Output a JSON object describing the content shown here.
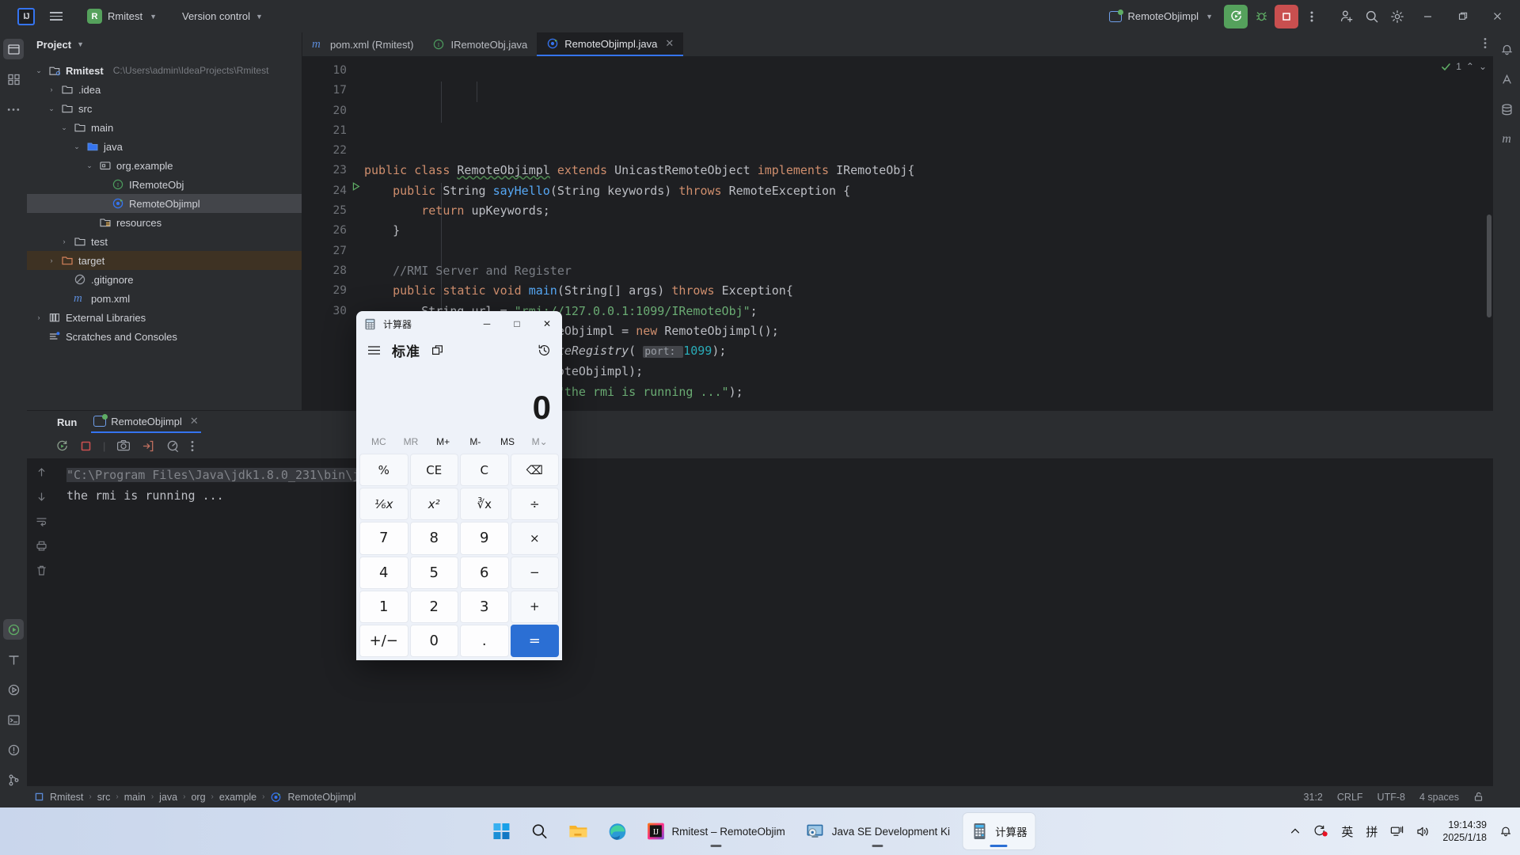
{
  "ide": {
    "toolbar": {
      "logo_initials": "IJ",
      "menu_icon": "hamburger-icon",
      "project_badge": "R",
      "project_name": "Rmitest",
      "version_control": "Version control",
      "run_config": "RemoteObjimpl",
      "icons": {
        "run": "run-icon",
        "debug": "debug-bug-icon",
        "stop": "stop-icon",
        "more": "more-vertical-icon",
        "account": "account-add-icon",
        "search": "search-icon",
        "settings": "gear-icon",
        "minimize": "minimize-icon",
        "restore": "restore-icon",
        "close": "close-icon"
      }
    },
    "project_panel": {
      "title": "Project",
      "tree": [
        {
          "label": "Rmitest",
          "path": "C:\\Users\\admin\\IdeaProjects\\Rmitest",
          "indent": 0,
          "arrow": "v",
          "icon": "module-icon",
          "bold": true,
          "state": "normal"
        },
        {
          "label": ".idea",
          "path": "",
          "indent": 1,
          "arrow": ">",
          "icon": "folder-icon",
          "bold": false,
          "state": "normal"
        },
        {
          "label": "src",
          "path": "",
          "indent": 1,
          "arrow": "v",
          "icon": "folder-icon",
          "bold": false,
          "state": "normal"
        },
        {
          "label": "main",
          "path": "",
          "indent": 2,
          "arrow": "v",
          "icon": "folder-icon",
          "bold": false,
          "state": "normal"
        },
        {
          "label": "java",
          "path": "",
          "indent": 3,
          "arrow": "v",
          "icon": "source-folder-icon",
          "bold": false,
          "state": "normal"
        },
        {
          "label": "org.example",
          "path": "",
          "indent": 4,
          "arrow": "v",
          "icon": "package-icon",
          "bold": false,
          "state": "normal"
        },
        {
          "label": "IRemoteObj",
          "path": "",
          "indent": 5,
          "arrow": "",
          "icon": "interface-icon",
          "bold": false,
          "state": "normal"
        },
        {
          "label": "RemoteObjimpl",
          "path": "",
          "indent": 5,
          "arrow": "",
          "icon": "class-runnable-icon",
          "bold": false,
          "state": "selected"
        },
        {
          "label": "resources",
          "path": "",
          "indent": 4,
          "arrow": "",
          "icon": "resources-folder-icon",
          "bold": false,
          "state": "normal"
        },
        {
          "label": "test",
          "path": "",
          "indent": 2,
          "arrow": ">",
          "icon": "folder-icon",
          "bold": false,
          "state": "normal"
        },
        {
          "label": "target",
          "path": "",
          "indent": 1,
          "arrow": ">",
          "icon": "excluded-folder-icon",
          "bold": false,
          "state": "target"
        },
        {
          "label": ".gitignore",
          "path": "",
          "indent": 2,
          "arrow": "",
          "icon": "gitignore-icon",
          "bold": false,
          "state": "normal"
        },
        {
          "label": "pom.xml",
          "path": "",
          "indent": 2,
          "arrow": "",
          "icon": "maven-icon",
          "bold": false,
          "state": "normal"
        },
        {
          "label": "External Libraries",
          "path": "",
          "indent": 0,
          "arrow": ">",
          "icon": "libraries-icon",
          "bold": false,
          "state": "normal"
        },
        {
          "label": "Scratches and Consoles",
          "path": "",
          "indent": 0,
          "arrow": "",
          "icon": "scratches-icon",
          "bold": false,
          "state": "normal"
        }
      ]
    },
    "editor": {
      "tabs": [
        {
          "label": "pom.xml (Rmitest)",
          "icon": "maven-icon",
          "active": false,
          "closable": false
        },
        {
          "label": "IRemoteObj.java",
          "icon": "interface-icon",
          "active": false,
          "closable": false
        },
        {
          "label": "RemoteObjimpl.java",
          "icon": "class-runnable-icon",
          "active": true,
          "closable": true
        }
      ],
      "inspection_count": "1",
      "line_numbers": [
        "10",
        "17",
        "20",
        "21",
        "22",
        "23",
        "24",
        "25",
        "26",
        "27",
        "28",
        "29",
        "30"
      ],
      "run_marker_line": "24"
    },
    "run_panel": {
      "title": "Run",
      "tab_label": "RemoteObjimpl",
      "toolbar_icons": [
        "rerun-icon",
        "stop-icon",
        "camera-icon",
        "export-icon",
        "profiler-icon",
        "more-vertical-icon"
      ],
      "side_icons": [
        "scroll-up-icon",
        "scroll-down-icon",
        "soft-wrap-icon",
        "print-icon",
        "trash-icon"
      ],
      "console": [
        {
          "text": "\"C:\\Program Files\\Java\\jdk1.8.0_231\\bin\\ja",
          "style": "dim"
        },
        {
          "text": "the rmi is running ...",
          "style": "out"
        }
      ]
    },
    "status_bar": {
      "breadcrumbs": [
        "Rmitest",
        "src",
        "main",
        "java",
        "org",
        "example",
        "RemoteObjimpl"
      ],
      "caret": "31:2",
      "line_sep": "CRLF",
      "encoding": "UTF-8",
      "indent": "4 spaces",
      "lock_icon": "lock-open-icon"
    }
  },
  "code": {
    "lines": [
      {
        "n": "10",
        "html": "kw:public |kw:class |cls:RemoteObjimpl| |kw:extends |cls:UnicastRemoteObject| |kw:implements |cls:IRemoteObj|pun:{"
      },
      {
        "n": "17",
        "html": "indent1|kw:public |cls:String |mtd:sayHello|pun:(|cls:String |pun:keywords) |kw:throws |cls:RemoteException |pun:{"
      },
      {
        "n": "20",
        "html": "indent2|kw:return |pun:upKeywords;"
      },
      {
        "n": "21",
        "html": "indent1|pun:}"
      },
      {
        "n": "22",
        "html": ""
      },
      {
        "n": "23",
        "html": "indent1|cmt://RMI Server and Register"
      },
      {
        "n": "24",
        "html": "indent1|kw:public static void |mtd:main|pun:(|cls:String|pun:[] args) |kw:throws |cls:Exception|pun:{"
      },
      {
        "n": "25",
        "html": "indent2|cls:String |pun:url = |str:\"rmi://127.0.0.1:1099/IRemoteObj\"|pun:;"
      },
      {
        "n": "26",
        "html": "indent2|cls:RemoteObjimpl |pun:remoteObjimpl = |kw:new |cls:RemoteObjimpl|pun:();"
      },
      {
        "n": "27",
        "html": "indent2|cls:LocateRegistry|pun:.|ital:createRegistry|pun:( |hint:port: |num:1099|pun:);"
      },
      {
        "n": "28",
        "html": "indent2|cls:Naming|pun:.|ital:bind|pun:(url,remoteObjimpl);"
      },
      {
        "n": "29",
        "html": "indent2|cls:System|pun:.|fld:out|pun:.|pun:println(|str:\"the rmi is running ...\"|pun:);"
      },
      {
        "n": "30",
        "html": "indent1|pun:}"
      }
    ]
  },
  "calculator": {
    "window_title": "计算器",
    "icon": "calculator-icon",
    "window_buttons": {
      "minimize": "─",
      "maximize": "□",
      "close": "✕"
    },
    "menu_icon": "hamburger-icon",
    "mode": "标准",
    "keep_on_top_icon": "keep-on-top-icon",
    "history_icon": "history-icon",
    "display_value": "0",
    "memory_keys": [
      {
        "label": "MC",
        "enabled": false
      },
      {
        "label": "MR",
        "enabled": false
      },
      {
        "label": "M+",
        "enabled": true
      },
      {
        "label": "M-",
        "enabled": true
      },
      {
        "label": "MS",
        "enabled": true
      },
      {
        "label": "M⌄",
        "enabled": false
      }
    ],
    "keys": [
      {
        "label": "%",
        "type": "fn"
      },
      {
        "label": "CE",
        "type": "fn"
      },
      {
        "label": "C",
        "type": "fn"
      },
      {
        "label": "⌫",
        "type": "fn"
      },
      {
        "label": "⅙x",
        "type": "fn-ital"
      },
      {
        "label": "x²",
        "type": "fn-ital"
      },
      {
        "label": "∛x",
        "type": "fn"
      },
      {
        "label": "÷",
        "type": "fn"
      },
      {
        "label": "7",
        "type": "num"
      },
      {
        "label": "8",
        "type": "num"
      },
      {
        "label": "9",
        "type": "num"
      },
      {
        "label": "×",
        "type": "fn"
      },
      {
        "label": "4",
        "type": "num"
      },
      {
        "label": "5",
        "type": "num"
      },
      {
        "label": "6",
        "type": "num"
      },
      {
        "label": "−",
        "type": "fn"
      },
      {
        "label": "1",
        "type": "num"
      },
      {
        "label": "2",
        "type": "num"
      },
      {
        "label": "3",
        "type": "num"
      },
      {
        "label": "+",
        "type": "fn"
      },
      {
        "label": "+/−",
        "type": "num"
      },
      {
        "label": "0",
        "type": "num"
      },
      {
        "label": ".",
        "type": "num"
      },
      {
        "label": "=",
        "type": "eq"
      }
    ]
  },
  "taskbar": {
    "items": [
      {
        "label": "",
        "icon": "windows-start-icon",
        "active": false,
        "running": false
      },
      {
        "label": "",
        "icon": "search-icon",
        "active": false,
        "running": false
      },
      {
        "label": "",
        "icon": "file-explorer-icon",
        "active": false,
        "running": false
      },
      {
        "label": "",
        "icon": "edge-icon",
        "active": false,
        "running": false
      },
      {
        "label": "Rmitest – RemoteObjim",
        "icon": "intellij-icon",
        "active": false,
        "running": true
      },
      {
        "label": "Java SE Development Ki",
        "icon": "java-installer-icon",
        "active": false,
        "running": true
      },
      {
        "label": "计算器",
        "icon": "calculator-icon",
        "active": true,
        "running": true
      }
    ],
    "tray": {
      "overflow_icon": "chevron-up-icon",
      "onedrive_icon": "sync-alert-icon",
      "ime_lang": "英",
      "ime_mode": "拼",
      "network_icon": "network-icon",
      "volume_icon": "volume-icon",
      "time": "19:14:39",
      "date": "2025/1/18",
      "notification_icon": "bell-icon"
    }
  },
  "colors": {
    "accent_blue": "#3574f0",
    "run_green": "#55a15c",
    "stop_red": "#c94f4f",
    "editor_bg": "#1e1f22",
    "panel_bg": "#2b2d30",
    "calc_accent": "#2b6fd4"
  }
}
